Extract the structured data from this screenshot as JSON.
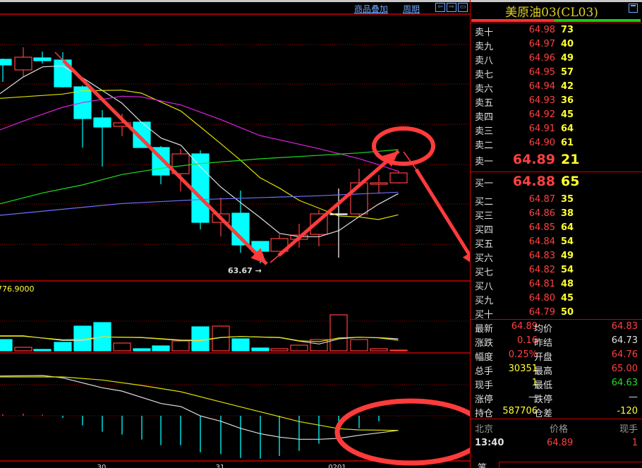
{
  "toolbar": {
    "overlay_label": "商品叠加",
    "period_label": "周期",
    "nav_left": "⇦",
    "nav_right": "⇨",
    "nav_panel": "▭"
  },
  "instrument": {
    "title": "美原油03(CL03)"
  },
  "chart": {
    "low_marker": "63.67",
    "volume_max_label": "776.9000",
    "dates": [
      "30",
      "31",
      "0201"
    ]
  },
  "colors": {
    "up": "#ff4040",
    "down": "#00ffff",
    "ma5": "#e0e0e0",
    "ma10": "#e0e000",
    "ma20": "#e020e0",
    "ma40": "#20e020",
    "ma60": "#7070ff",
    "annotation": "#ff3b3b"
  },
  "order_book": {
    "sell": [
      {
        "label": "卖十",
        "price": "64.98",
        "vol": "73"
      },
      {
        "label": "卖九",
        "price": "64.97",
        "vol": "40"
      },
      {
        "label": "卖八",
        "price": "64.96",
        "vol": "49"
      },
      {
        "label": "卖七",
        "price": "64.95",
        "vol": "57"
      },
      {
        "label": "卖六",
        "price": "64.94",
        "vol": "42"
      },
      {
        "label": "卖五",
        "price": "64.93",
        "vol": "36"
      },
      {
        "label": "卖四",
        "price": "64.92",
        "vol": "45"
      },
      {
        "label": "卖三",
        "price": "64.91",
        "vol": "64"
      },
      {
        "label": "卖二",
        "price": "64.90",
        "vol": "61"
      },
      {
        "label": "卖一",
        "price": "64.89",
        "vol": "21"
      }
    ],
    "buy": [
      {
        "label": "买一",
        "price": "64.88",
        "vol": "65"
      },
      {
        "label": "买二",
        "price": "64.87",
        "vol": "35"
      },
      {
        "label": "买三",
        "price": "64.86",
        "vol": "38"
      },
      {
        "label": "买四",
        "price": "64.85",
        "vol": "64"
      },
      {
        "label": "买五",
        "price": "64.84",
        "vol": "54"
      },
      {
        "label": "买六",
        "price": "64.83",
        "vol": "49"
      },
      {
        "label": "买七",
        "price": "64.82",
        "vol": "54"
      },
      {
        "label": "买八",
        "price": "64.81",
        "vol": "48"
      },
      {
        "label": "买九",
        "price": "64.80",
        "vol": "45"
      },
      {
        "label": "买十",
        "price": "64.79",
        "vol": "50"
      }
    ]
  },
  "stats": [
    {
      "l1": "最新",
      "v1": "64.89",
      "c1": "#ff4040",
      "l2": "均价",
      "v2": "64.83",
      "c2": "#ff4040"
    },
    {
      "l1": "涨跌",
      "v1": "0.16",
      "c1": "#ff4040",
      "l2": "昨结",
      "v2": "64.73",
      "c2": "#e0e0e0"
    },
    {
      "l1": "幅度",
      "v1": "0.25%",
      "c1": "#ff4040",
      "l2": "开盘",
      "v2": "64.76",
      "c2": "#ff4040"
    },
    {
      "l1": "总手",
      "v1": "30351",
      "c1": "#ffff30",
      "l2": "最高",
      "v2": "65.00",
      "c2": "#ff4040"
    },
    {
      "l1": "现手",
      "v1": "1",
      "c1": "#ffff30",
      "l2": "最低",
      "v2": "64.63",
      "c2": "#20e020"
    },
    {
      "l1": "涨停",
      "v1": "—",
      "c1": "#e0e0e0",
      "l2": "跌停",
      "v2": "—",
      "c2": "#e0e0e0"
    },
    {
      "l1": "持仓",
      "v1": "587706",
      "c1": "#ffff30",
      "l2": "仓差",
      "v2": "-120",
      "c2": "#ffff30"
    }
  ],
  "ticks": {
    "headers": [
      "北京",
      "价格",
      "现手"
    ],
    "rows": [
      {
        "time": "13:40",
        "price": "64.89",
        "vol": "1"
      }
    ]
  },
  "bottom_tab": "笔"
}
